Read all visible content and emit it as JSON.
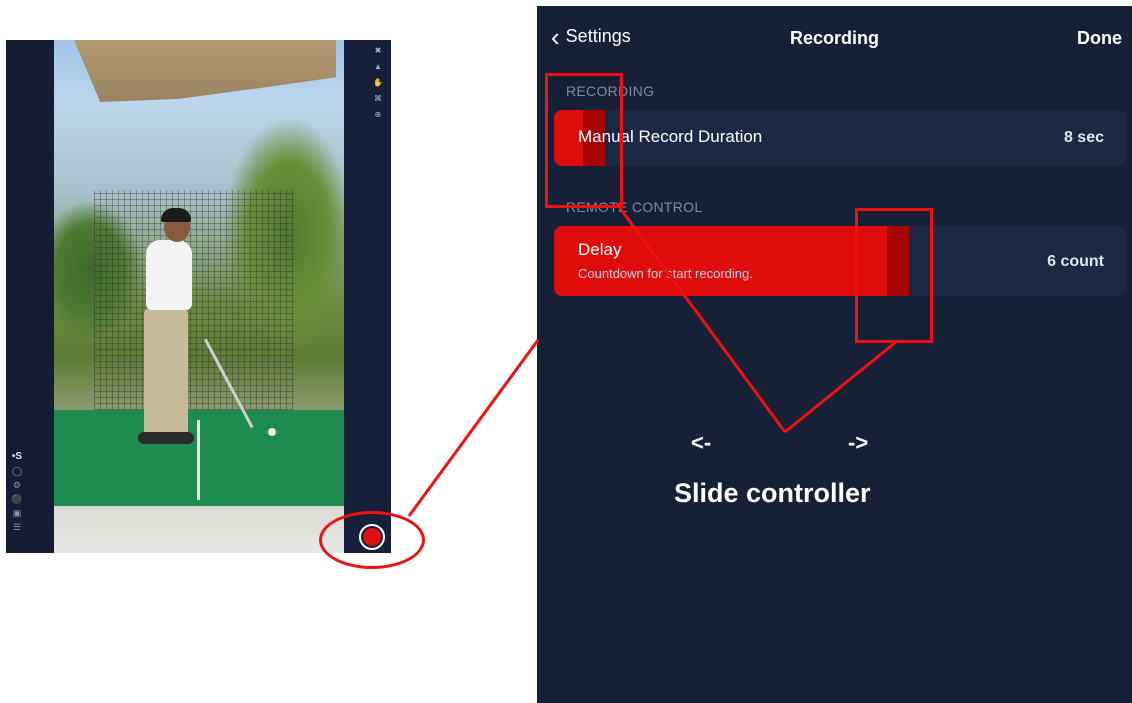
{
  "phone": {
    "rail_logo": "•S",
    "left_tools": [
      "circle-outline-icon",
      "settings-icon",
      "bulb-icon",
      "camera-icon",
      "menu-icon"
    ],
    "right_tools": [
      "close-icon",
      "tree-icon",
      "hand-icon",
      "command-icon",
      "target-icon"
    ],
    "record_color": "#e01010"
  },
  "settings": {
    "nav": {
      "back_label": "Settings",
      "title": "Recording",
      "done_label": "Done"
    },
    "sections": [
      {
        "header": "RECORDING",
        "rows": [
          {
            "label": "Manual Record Duration",
            "value": "8 sec",
            "slider_fraction": 0.09
          }
        ]
      },
      {
        "header": "REMOTE CONTROL",
        "rows": [
          {
            "label": "Delay",
            "sublabel": "Countdown for start recording.",
            "value": "6 count",
            "slider_fraction": 0.62
          }
        ]
      }
    ]
  },
  "annotation": {
    "left_arrow": "<-",
    "right_arrow": "->",
    "caption": "Slide controller",
    "accent": "#ee1111"
  }
}
